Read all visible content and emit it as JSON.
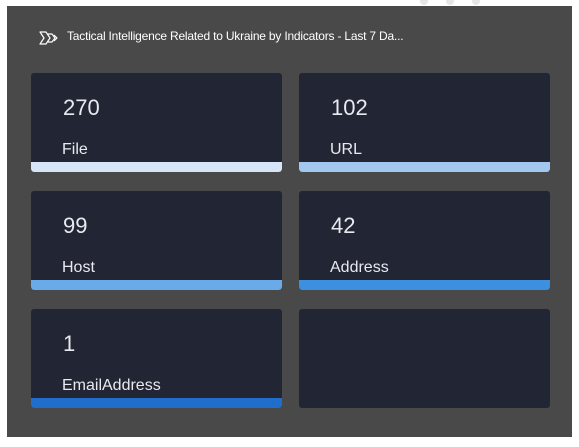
{
  "widget": {
    "title": "Tactical Intelligence Related to Ukraine by Indicators - Last 7 Da...",
    "icon": "indicator-icon"
  },
  "tiles": [
    {
      "count": "270",
      "label": "File",
      "bar_color": "#d6e6f7"
    },
    {
      "count": "102",
      "label": "URL",
      "bar_color": "#a3c8f0"
    },
    {
      "count": "99",
      "label": "Host",
      "bar_color": "#6aaae9"
    },
    {
      "count": "42",
      "label": "Address",
      "bar_color": "#3d8fe0"
    },
    {
      "count": "1",
      "label": "EmailAddress",
      "bar_color": "#1f6ecb"
    }
  ],
  "colors": {
    "widget_bg": "#494949",
    "tile_bg": "#222533",
    "text": "#e8eaf0"
  }
}
